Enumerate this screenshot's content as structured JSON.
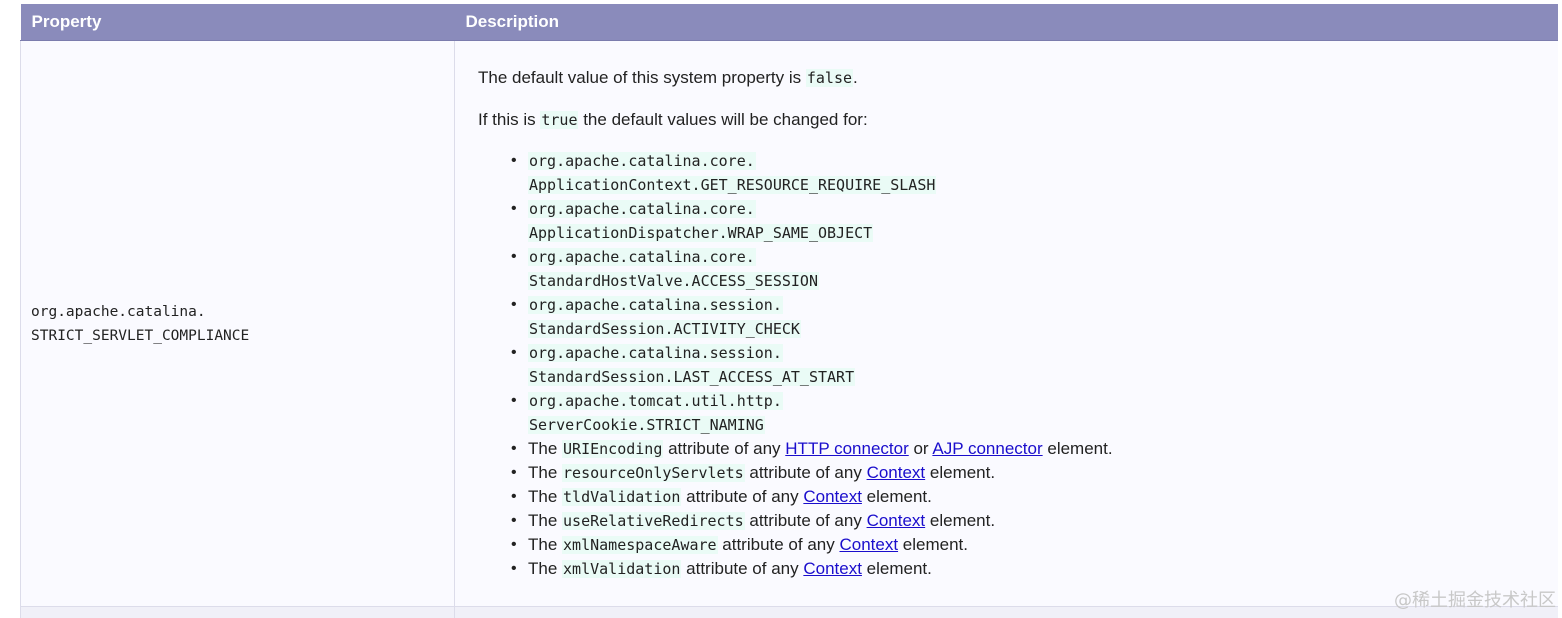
{
  "table": {
    "headers": [
      "Property",
      "Description"
    ],
    "property": {
      "line1": "org.apache.catalina.",
      "line2": "STRICT_SERVLET_COMPLIANCE"
    },
    "description": {
      "p1_prefix": "The default value of this system property is ",
      "p1_code": "false",
      "p1_suffix": ".",
      "p2_prefix": "If this is ",
      "p2_code": "true",
      "p2_suffix": " the default values will be changed for:",
      "code_items": [
        {
          "line1": "org.apache.catalina.core.",
          "line2": "ApplicationContext.GET_RESOURCE_REQUIRE_SLASH"
        },
        {
          "line1": "org.apache.catalina.core.",
          "line2": "ApplicationDispatcher.WRAP_SAME_OBJECT"
        },
        {
          "line1": "org.apache.catalina.core.",
          "line2": "StandardHostValve.ACCESS_SESSION"
        },
        {
          "line1": "org.apache.catalina.session.",
          "line2": "StandardSession.ACTIVITY_CHECK"
        },
        {
          "line1": "org.apache.catalina.session.",
          "line2": "StandardSession.LAST_ACCESS_AT_START"
        },
        {
          "line1": "org.apache.tomcat.util.http.",
          "line2": "ServerCookie.STRICT_NAMING"
        }
      ],
      "attr_items": [
        {
          "prefix": "The ",
          "code": "URIEncoding",
          "mid": " attribute of any ",
          "link1": "HTTP connector",
          "or": " or ",
          "link2": "AJP connector",
          "suffix": " element."
        },
        {
          "prefix": "The ",
          "code": "resourceOnlyServlets",
          "mid": " attribute of any ",
          "link1": "Context",
          "suffix": " element."
        },
        {
          "prefix": "The ",
          "code": "tldValidation",
          "mid": " attribute of any ",
          "link1": "Context",
          "suffix": " element."
        },
        {
          "prefix": "The ",
          "code": "useRelativeRedirects",
          "mid": " attribute of any ",
          "link1": "Context",
          "suffix": " element."
        },
        {
          "prefix": "The ",
          "code": "xmlNamespaceAware",
          "mid": " attribute of any ",
          "link1": "Context",
          "suffix": " element."
        },
        {
          "prefix": "The ",
          "code": "xmlValidation",
          "mid": " attribute of any ",
          "link1": "Context",
          "suffix": " element."
        }
      ]
    }
  },
  "watermark": "@稀土掘金技术社区",
  "colors": {
    "header_bg": "#8a8bbb",
    "code_bg": "#eafbf6",
    "link": "#1a0dcc"
  }
}
